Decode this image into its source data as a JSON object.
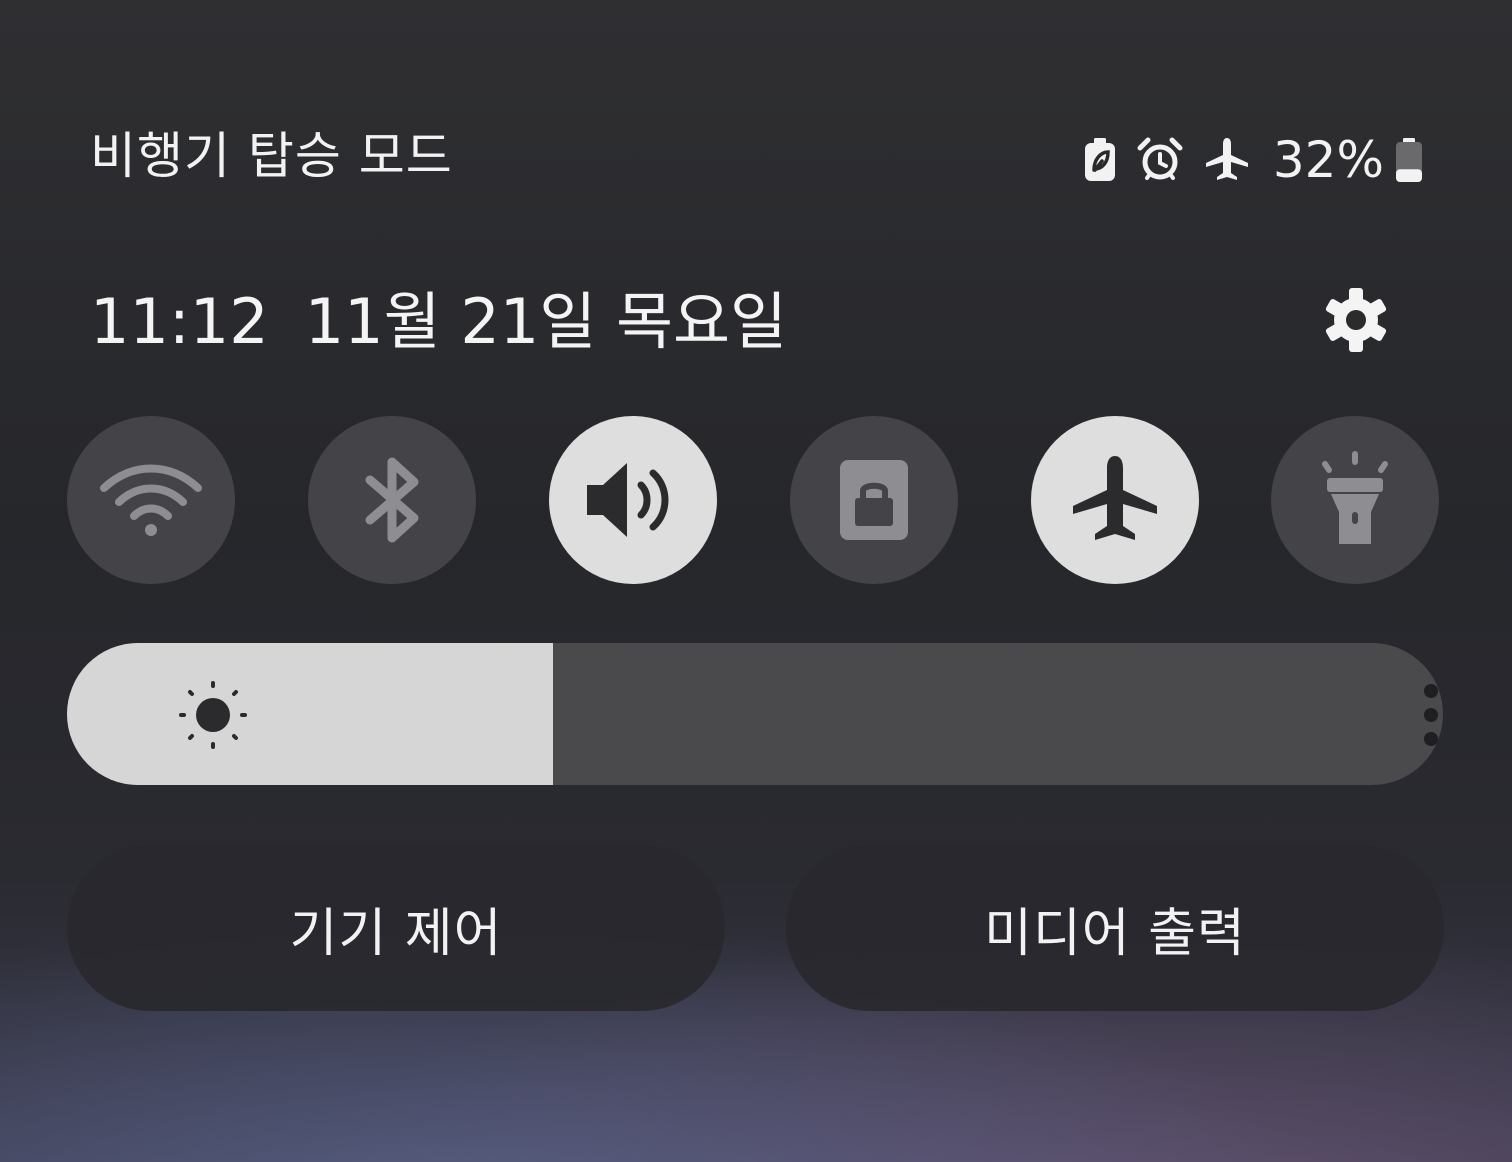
{
  "status_bar": {
    "title": "비행기 탑승 모드",
    "battery_percent": "32%",
    "icons": [
      "battery-saver-icon",
      "alarm-icon",
      "airplane-icon",
      "battery-icon"
    ],
    "battery_level": 0.32
  },
  "header": {
    "time": "11:12",
    "date": "11월 21일 목요일",
    "settings_icon": "gear-icon"
  },
  "quick_settings": [
    {
      "icon": "wifi-icon",
      "state": "off"
    },
    {
      "icon": "bluetooth-icon",
      "state": "off"
    },
    {
      "icon": "sound-icon",
      "state": "on"
    },
    {
      "icon": "rotation-lock-icon",
      "state": "off"
    },
    {
      "icon": "airplane-mode-icon",
      "state": "on"
    },
    {
      "icon": "flashlight-icon",
      "state": "off"
    }
  ],
  "brightness": {
    "level_fraction": 0.353,
    "icon": "sun-icon",
    "more_icon": "more-vertical-icon"
  },
  "buttons": {
    "device_control": "기기 제어",
    "media_output": "미디어 출력"
  },
  "colors": {
    "tile_on": "#dedede",
    "tile_off": "#444448",
    "icon_off": "#8e8e92",
    "icon_on": "#2b2b2e"
  }
}
